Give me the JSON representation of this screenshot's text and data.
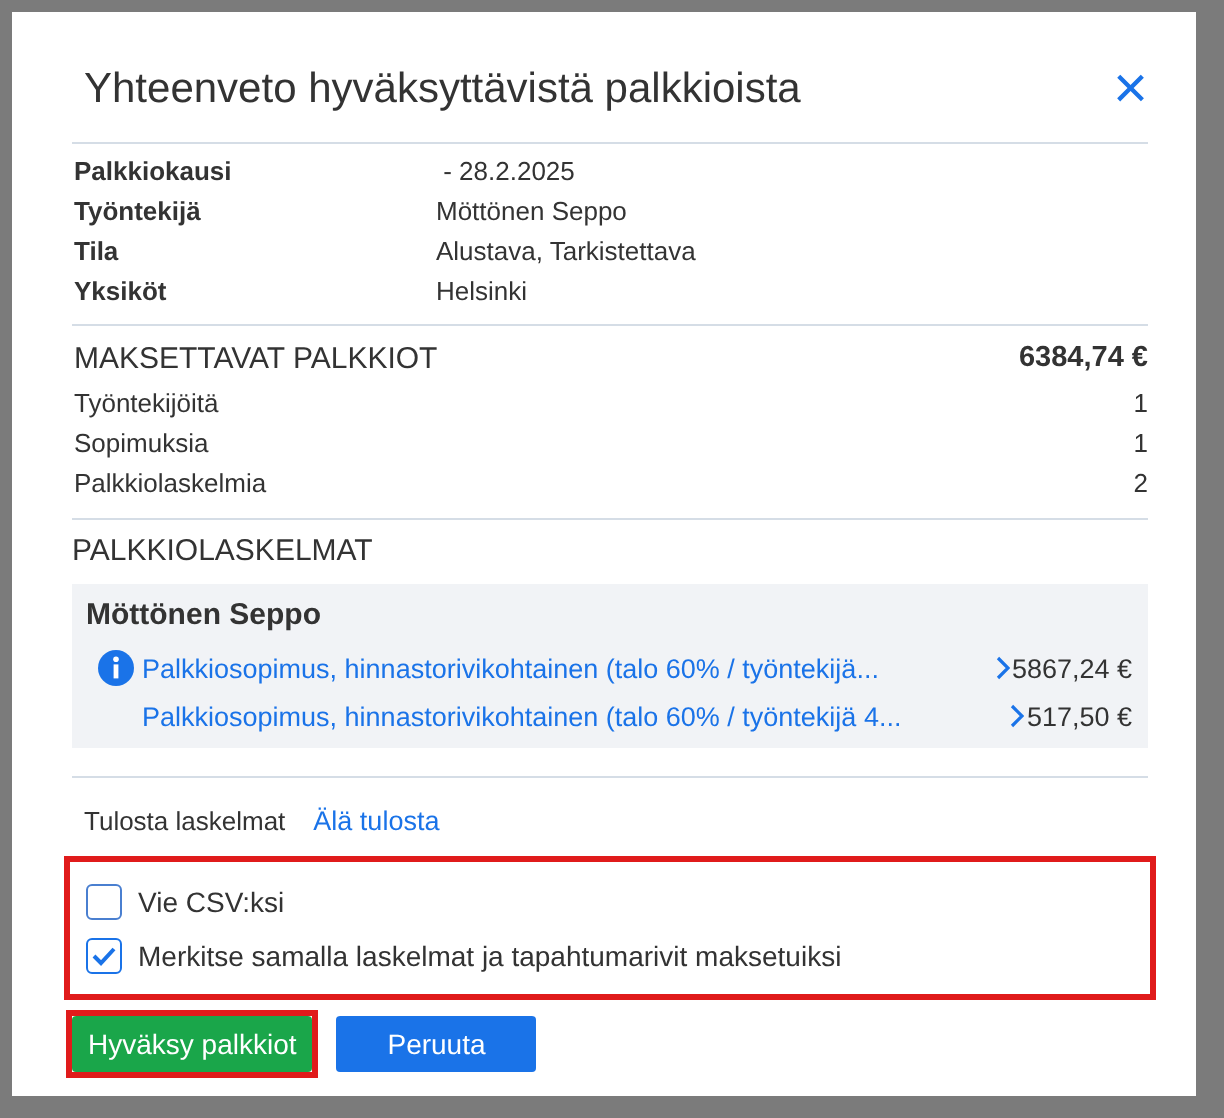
{
  "dialog": {
    "title": "Yhteenveto hyväksyttävistä palkkioista",
    "close_icon": "×"
  },
  "details": [
    {
      "label": "Palkkiokausi",
      "value": " - 28.2.2025"
    },
    {
      "label": "Työntekijä",
      "value": "Möttönen Seppo"
    },
    {
      "label": "Tila",
      "value": "Alustava, Tarkistettava"
    },
    {
      "label": "Yksiköt",
      "value": "Helsinki"
    }
  ],
  "payable": {
    "heading": "MAKSETTAVAT PALKKIOT",
    "total": "6384,74 €",
    "rows": [
      {
        "label": "Työntekijöitä",
        "value": "1"
      },
      {
        "label": "Sopimuksia",
        "value": "1"
      },
      {
        "label": "Palkkiolaskelmia",
        "value": "2"
      }
    ]
  },
  "statements": {
    "heading": "PALKKIOLASKELMAT",
    "employee": "Möttönen Seppo",
    "items": [
      {
        "info": true,
        "label": "Palkkiosopimus, hinnastorivikohtainen (talo 60% / työntekijä...",
        "amount": "5867,24 €"
      },
      {
        "info": false,
        "label": "Palkkiosopimus, hinnastorivikohtainen (talo 60% / työntekijä 4...",
        "amount": "517,50 €"
      }
    ]
  },
  "print": {
    "label": "Tulosta laskelmat",
    "link": "Älä tulosta"
  },
  "options": {
    "highlighted": true,
    "items": [
      {
        "label": "Vie CSV:ksi",
        "checked": false
      },
      {
        "label": "Merkitse samalla laskelmat ja tapahtumarivit maksetuiksi",
        "checked": true
      }
    ]
  },
  "buttons": [
    {
      "label": "Hyväksy palkkiot",
      "kind": "success",
      "highlighted": true
    },
    {
      "label": "Peruuta",
      "kind": "primary",
      "highlighted": false
    }
  ]
}
